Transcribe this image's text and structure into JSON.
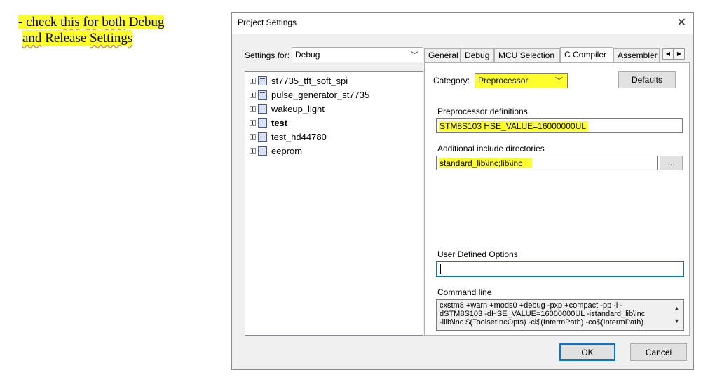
{
  "note": {
    "line1_a": "- check ",
    "line1_b": "this",
    "line1_c": " ",
    "line1_d": "for",
    "line1_e": " ",
    "line1_f": "both",
    "line1_g": " Debug",
    "line2_a": "and",
    "line2_b": " Release ",
    "line2_c": "Settings"
  },
  "dialog": {
    "title": "Project Settings",
    "close_icon": "close-icon",
    "settings_for_label": "Settings for:",
    "settings_for_value": "Debug",
    "tree": [
      {
        "label": "st7735_tft_soft_spi",
        "bold": false
      },
      {
        "label": "pulse_generator_st7735",
        "bold": false
      },
      {
        "label": "wakeup_light",
        "bold": false
      },
      {
        "label": "test",
        "bold": true
      },
      {
        "label": "test_hd44780",
        "bold": false
      },
      {
        "label": "eeprom",
        "bold": false
      }
    ],
    "tabs": [
      "General",
      "Debug",
      "MCU Selection",
      "C Compiler",
      "Assembler"
    ],
    "active_tab": "C Compiler",
    "category_label": "Category:",
    "category_value": "Preprocessor",
    "defaults_button": "Defaults",
    "preproc_label": "Preprocessor definitions",
    "preproc_value": "STM8S103 HSE_VALUE=16000000UL",
    "include_label": "Additional include directories",
    "include_value": "standard_lib\\inc;lib\\inc",
    "browse_button": "...",
    "user_options_label": "User Defined Options",
    "user_options_value": "",
    "cmdline_label": "Command line",
    "cmdline_value": "cxstm8 +warn +mods0 +debug -pxp +compact -pp -l -\ndSTM8S103 -dHSE_VALUE=16000000UL -istandard_lib\\inc\n-ilib\\inc $(ToolsetIncOpts) -cl$(IntermPath) -co$(IntermPath)",
    "ok_button": "OK",
    "cancel_button": "Cancel"
  },
  "colors": {
    "highlight": "#ffff2a",
    "focus_border": "#0078d7"
  }
}
